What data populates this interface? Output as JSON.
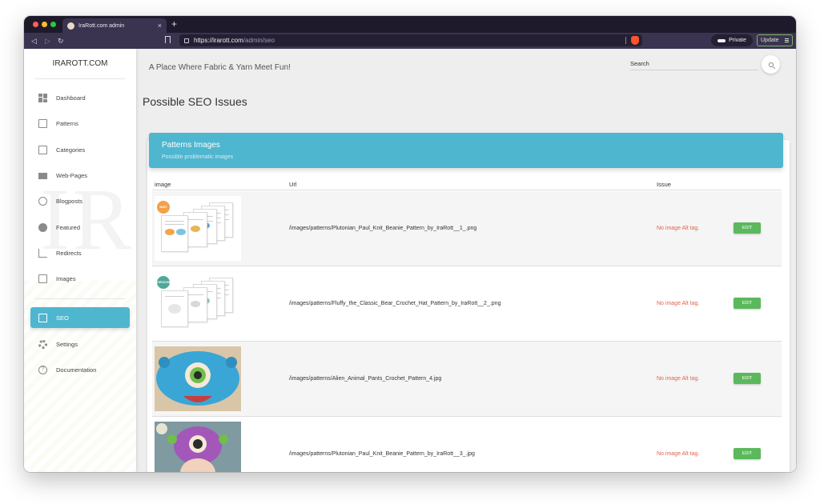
{
  "browser": {
    "tab_title": "IraRott.com admin",
    "tab_close": "×",
    "new_tab": "+",
    "url_host": "https://irarott.com",
    "url_path": "/admin/seo",
    "private_label": "Private",
    "update_label": "Update"
  },
  "sidebar": {
    "brand": "IRAROTT.COM",
    "items": [
      {
        "label": "Dashboard",
        "icon": "dashboard-icon"
      },
      {
        "label": "Patterns",
        "icon": "image-icon"
      },
      {
        "label": "Categories",
        "icon": "clipboard-icon"
      },
      {
        "label": "Web-Pages",
        "icon": "webpage-icon"
      },
      {
        "label": "Blogposts",
        "icon": "globe-icon"
      },
      {
        "label": "Featured",
        "icon": "star-icon"
      },
      {
        "label": "Redirects",
        "icon": "crop-icon"
      },
      {
        "label": "Images",
        "icon": "image-icon"
      },
      {
        "label": "SEO",
        "icon": "seo-icon",
        "active": true
      },
      {
        "label": "Settings",
        "icon": "gear-icon"
      },
      {
        "label": "Documentation",
        "icon": "help-icon"
      }
    ]
  },
  "header": {
    "tagline": "A Place Where Fabric & Yarn Meet Fun!",
    "search_label": "Search"
  },
  "main": {
    "title": "Possible SEO Issues",
    "card": {
      "title": "Patterns Images",
      "subtitle": "Possible problematic images"
    },
    "table": {
      "columns": [
        "image",
        "Url",
        "Issue"
      ],
      "rows": [
        {
          "url": "/images/patterns/Plutonian_Paul_Knit_Beanie_Pattern_by_IraRott__1_.png",
          "issue": "No image Alt tag.",
          "action": "EDIT",
          "badge": "KNIT"
        },
        {
          "url": "/images/patterns/Fluffy_the_Classic_Bear_Crochet_Hat_Pattern_by_IraRott__2_.png",
          "issue": "No image Alt tag.",
          "action": "EDIT",
          "badge": "CROCHET"
        },
        {
          "url": "/images/patterns/Alien_Animal_Pants_Crochet_Pattern_4.jpg",
          "issue": "No image Alt tag.",
          "action": "EDIT"
        },
        {
          "url": "/images/patterns/Plutonian_Paul_Knit_Beanie_Pattern_by_IraRott__3_.jpg",
          "issue": "No image Alt tag.",
          "action": "EDIT"
        }
      ]
    }
  },
  "colors": {
    "accent": "#4fb6cf",
    "issue": "#e0644c",
    "edit_button": "#5cb85c"
  }
}
